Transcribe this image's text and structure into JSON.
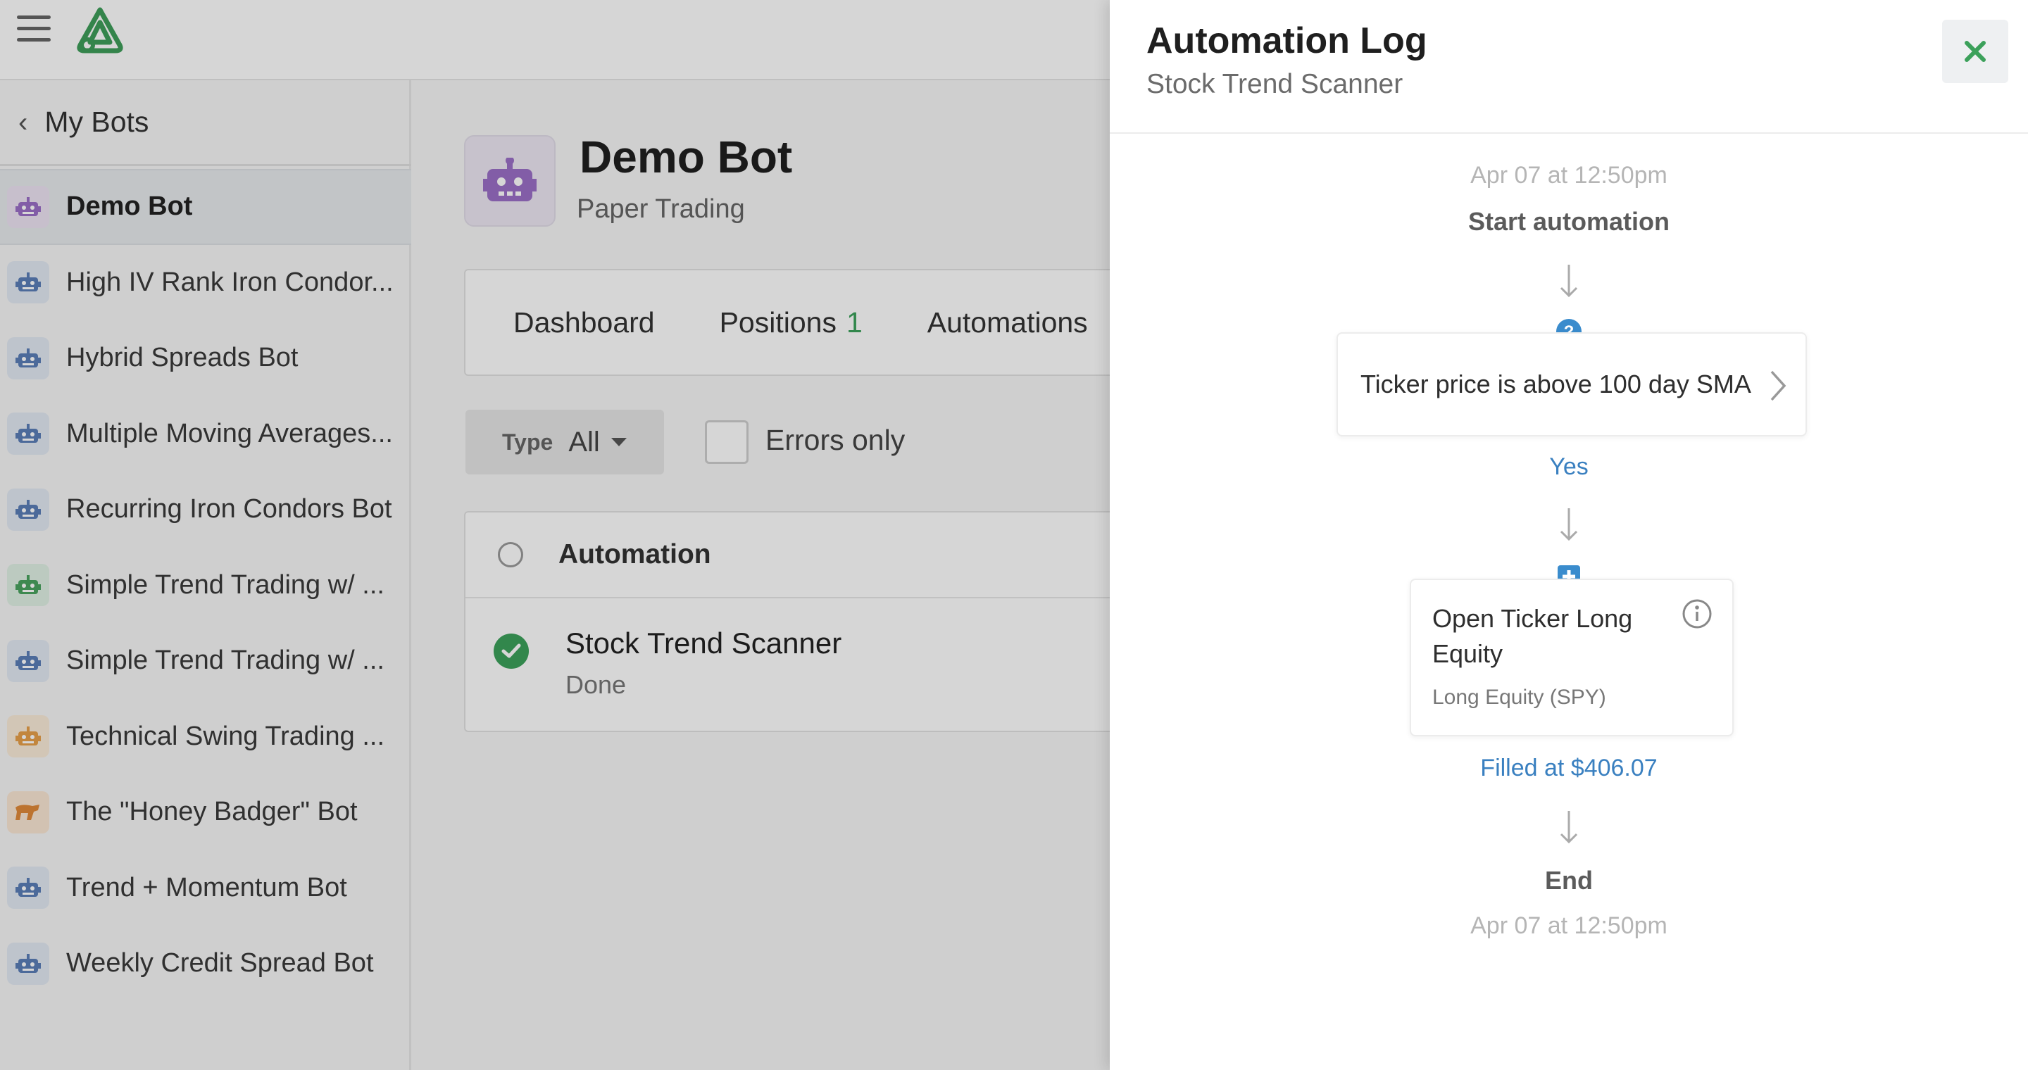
{
  "sidebar": {
    "back_label": "My Bots",
    "items": [
      {
        "label": "Demo Bot",
        "icon": "robot-icon",
        "color": "#9b6fc7",
        "bg": "#ede4f4",
        "active": true
      },
      {
        "label": "High IV Rank Iron Condor...",
        "icon": "robot-icon",
        "color": "#5b7fb8",
        "bg": "#e3eaf4"
      },
      {
        "label": "Hybrid Spreads Bot",
        "icon": "robot-icon",
        "color": "#5b7fb8",
        "bg": "#e3eaf4"
      },
      {
        "label": "Multiple Moving Averages...",
        "icon": "robot-icon",
        "color": "#5b7fb8",
        "bg": "#e3eaf4"
      },
      {
        "label": "Recurring Iron Condors Bot",
        "icon": "robot-icon",
        "color": "#5b7fb8",
        "bg": "#e3eaf4"
      },
      {
        "label": "Simple Trend Trading w/ ...",
        "icon": "robot-icon",
        "color": "#4aa460",
        "bg": "#e1f1e5"
      },
      {
        "label": "Simple Trend Trading w/ ...",
        "icon": "robot-icon",
        "color": "#5b7fb8",
        "bg": "#e3eaf4"
      },
      {
        "label": "Technical Swing Trading ...",
        "icon": "robot-icon",
        "color": "#e7a04b",
        "bg": "#fbecd9"
      },
      {
        "label": "The \"Honey Badger\" Bot",
        "icon": "badger-icon",
        "color": "#e08a3a",
        "bg": "#fbe7d4"
      },
      {
        "label": "Trend + Momentum Bot",
        "icon": "robot-icon",
        "color": "#5b7fb8",
        "bg": "#e3eaf4"
      },
      {
        "label": "Weekly Credit Spread Bot",
        "icon": "robot-icon",
        "color": "#5b7fb8",
        "bg": "#e3eaf4"
      }
    ]
  },
  "bot": {
    "title": "Demo Bot",
    "subtitle": "Paper Trading"
  },
  "tabs": [
    {
      "label": "Dashboard",
      "count": ""
    },
    {
      "label": "Positions",
      "count": "1"
    },
    {
      "label": "Automations",
      "count": ""
    }
  ],
  "filters": {
    "type_key": "Type",
    "type_value": "All",
    "errors_label": "Errors only"
  },
  "table": {
    "header": "Automation",
    "rows": [
      {
        "name": "Stock Trend Scanner",
        "status": "Done"
      }
    ]
  },
  "drawer": {
    "title": "Automation Log",
    "subtitle": "Stock Trend Scanner",
    "flow": {
      "start_time": "Apr 07 at 12:50pm",
      "start_label": "Start automation",
      "condition": "Ticker price is above 100 day SMA",
      "branch": "Yes",
      "action_title": "Open Ticker Long Equity",
      "action_sub": "Long Equity (SPY)",
      "action_result": "Filled at $406.07",
      "end_label": "End",
      "end_time": "Apr 07 at 12:50pm"
    }
  },
  "colors": {
    "accent_green": "#3ca15b",
    "link_blue": "#3a80c0",
    "brand_green": "#3f9e5a"
  }
}
